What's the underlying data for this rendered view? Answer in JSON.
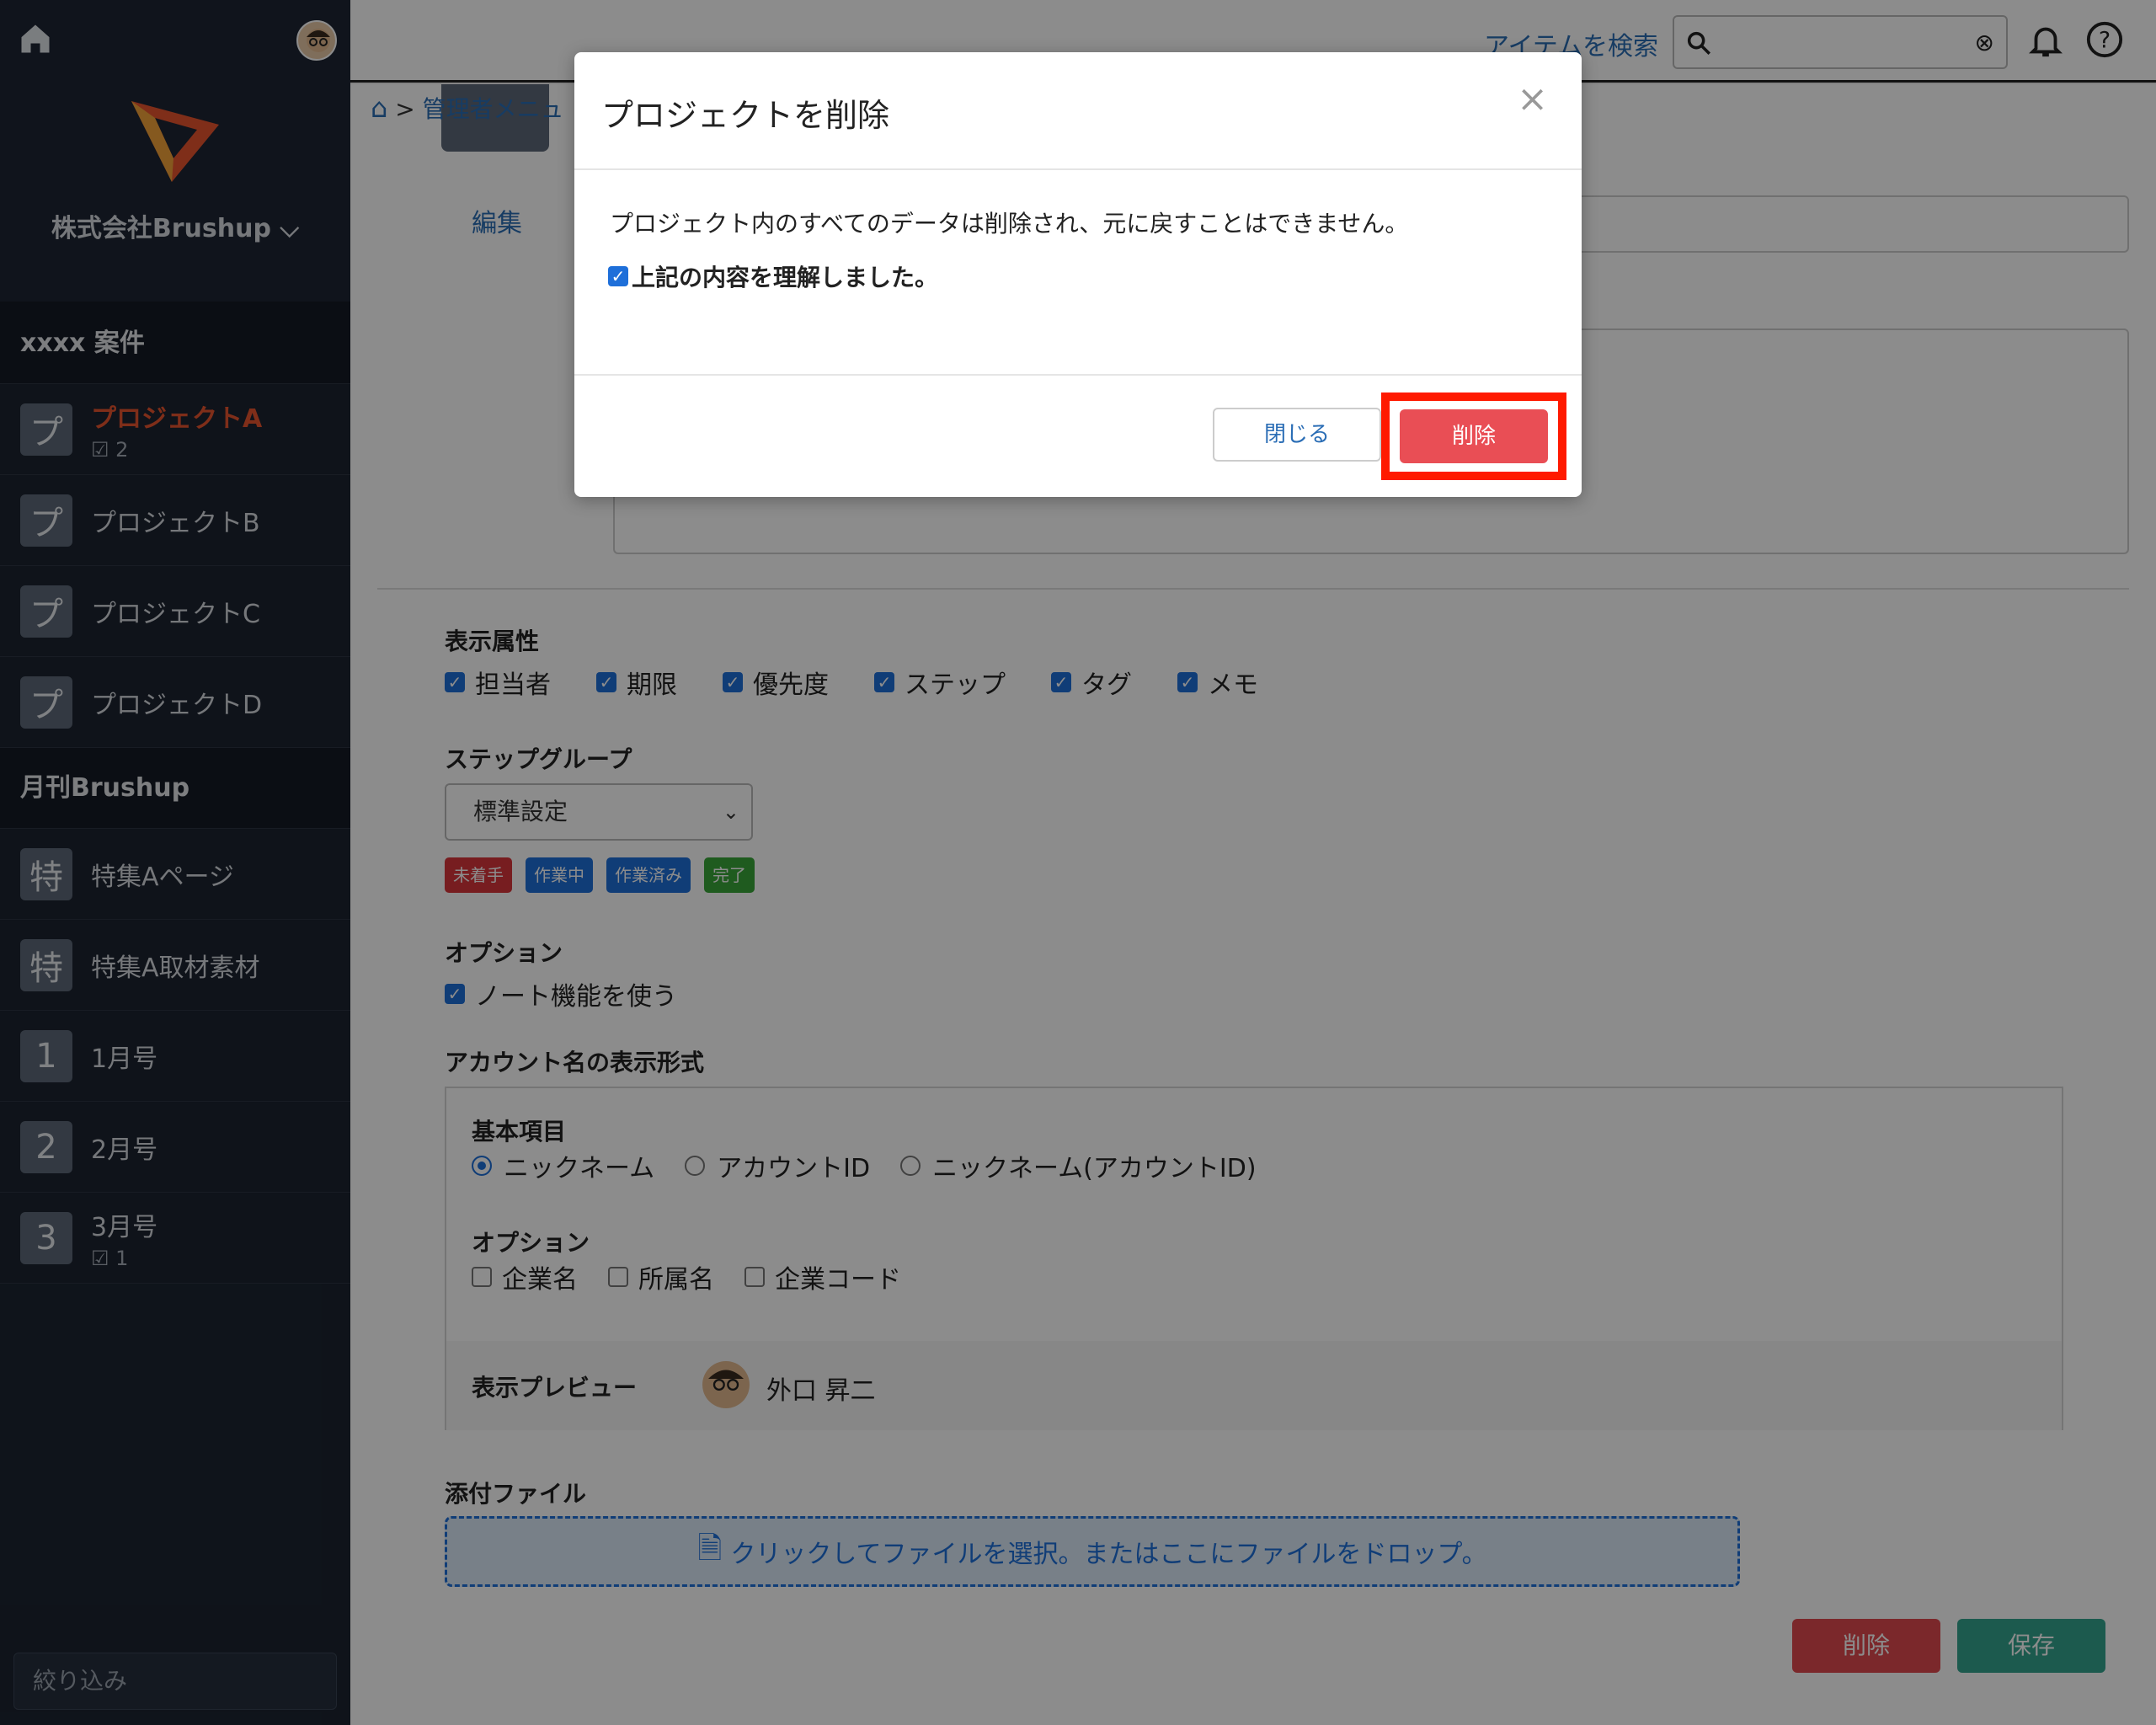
{
  "header": {
    "search_link": "アイテムを検索",
    "breadcrumb": "管理者メニュ"
  },
  "sidebar": {
    "company": "株式会社Brushup",
    "groups": [
      {
        "title": "xxxx 案件",
        "items": [
          {
            "tile": "プ",
            "label": "プロジェクトA",
            "sub": "2",
            "active": true
          },
          {
            "tile": "プ",
            "label": "プロジェクトB"
          },
          {
            "tile": "プ",
            "label": "プロジェクトC"
          },
          {
            "tile": "プ",
            "label": "プロジェクトD"
          }
        ]
      },
      {
        "title": "月刊Brushup",
        "items": [
          {
            "tile": "特",
            "label": "特集Aページ"
          },
          {
            "tile": "特",
            "label": "特集A取材素材"
          },
          {
            "tile": "1",
            "label": "1月号"
          },
          {
            "tile": "2",
            "label": "2月号"
          },
          {
            "tile": "3",
            "label": "3月号",
            "sub": "1"
          }
        ]
      }
    ],
    "filter_placeholder": "絞り込み"
  },
  "form": {
    "edit_link": "編集",
    "display_attrs_title": "表示属性",
    "display_attrs": [
      "担当者",
      "期限",
      "優先度",
      "ステップ",
      "タグ",
      "メモ"
    ],
    "step_group_title": "ステップグループ",
    "step_group_value": "標準設定",
    "step_badges": [
      {
        "label": "未着手",
        "color": "#d9353b"
      },
      {
        "label": "作業中",
        "color": "#1e6fd9"
      },
      {
        "label": "作業済み",
        "color": "#1e6fd9"
      },
      {
        "label": "完了",
        "color": "#3aa63a"
      }
    ],
    "option_title": "オプション",
    "option_note": "ノート機能を使う",
    "account_title": "アカウント名の表示形式",
    "basic_title": "基本項目",
    "basic_options": [
      "ニックネーム",
      "アカウントID",
      "ニックネーム(アカウントID)"
    ],
    "acct_option_title": "オプション",
    "acct_options": [
      "企業名",
      "所属名",
      "企業コード"
    ],
    "preview_title": "表示プレビュー",
    "preview_name": "外口 昇二",
    "attach_title": "添付ファイル",
    "dropzone_text": "クリックしてファイルを選択。またはここにファイルをドロップ。",
    "delete_label": "削除",
    "save_label": "保存"
  },
  "modal": {
    "title": "プロジェクトを削除",
    "message": "プロジェクト内のすべてのデータは削除され、元に戻すことはできません。",
    "agree_label": "上記の内容を理解しました。",
    "close_label": "閉じる",
    "delete_label": "削除",
    "close_icon": "×"
  }
}
